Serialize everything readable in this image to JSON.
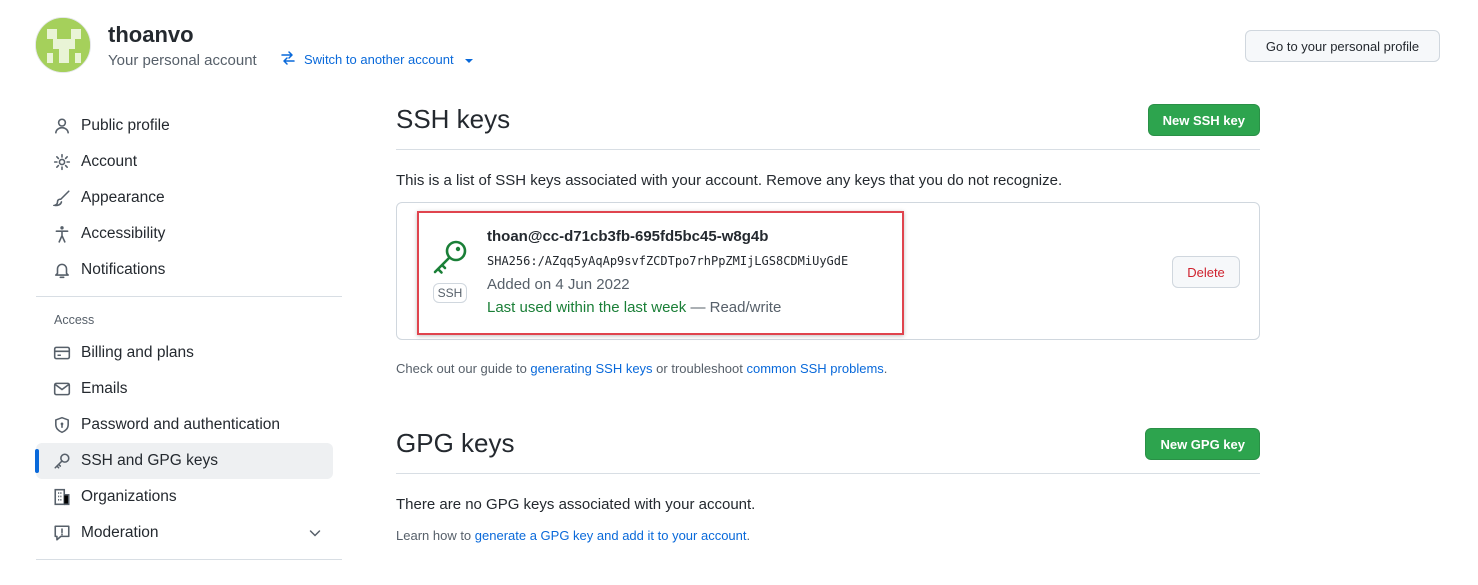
{
  "header": {
    "username": "thoanvo",
    "subtitle": "Your personal account",
    "switch_label": "Switch to another account",
    "profile_button": "Go to your personal profile"
  },
  "sidebar": {
    "items": [
      {
        "label": "Public profile",
        "icon": "person-icon"
      },
      {
        "label": "Account",
        "icon": "gear-icon"
      },
      {
        "label": "Appearance",
        "icon": "paintbrush-icon"
      },
      {
        "label": "Accessibility",
        "icon": "accessibility-icon"
      },
      {
        "label": "Notifications",
        "icon": "bell-icon"
      }
    ],
    "access_label": "Access",
    "access_items": [
      {
        "label": "Billing and plans",
        "icon": "credit-card-icon"
      },
      {
        "label": "Emails",
        "icon": "mail-icon"
      },
      {
        "label": "Password and authentication",
        "icon": "shield-lock-icon"
      },
      {
        "label": "SSH and GPG keys",
        "icon": "key-icon",
        "active": true
      },
      {
        "label": "Organizations",
        "icon": "organization-icon"
      },
      {
        "label": "Moderation",
        "icon": "report-icon"
      }
    ]
  },
  "ssh": {
    "title": "SSH keys",
    "new_button": "New SSH key",
    "description": "This is a list of SSH keys associated with your account. Remove any keys that you do not recognize.",
    "key": {
      "badge": "SSH",
      "title": "thoan@cc-d71cb3fb-695fd5bc45-w8g4b",
      "fingerprint": "SHA256:/AZqq5yAqAp9svfZCDTpo7rhPpZMIjLGS8CDMiUyGdE",
      "added": "Added on 4 Jun 2022",
      "last_used": "Last used within the last week",
      "access": " — Read/write",
      "delete_button": "Delete"
    },
    "guide_prefix": "Check out our guide to ",
    "guide_link1": "generating SSH keys",
    "guide_middle": " or troubleshoot ",
    "guide_link2": "common SSH problems",
    "guide_suffix": "."
  },
  "gpg": {
    "title": "GPG keys",
    "new_button": "New GPG key",
    "description": "There are no GPG keys associated with your account.",
    "learn_prefix": "Learn how to ",
    "learn_link": "generate a GPG key and add it to your account",
    "learn_suffix": "."
  },
  "colors": {
    "accent": "#0969da",
    "green": "#2da44e",
    "danger": "#cf222e",
    "highlight": "#e0444e"
  }
}
